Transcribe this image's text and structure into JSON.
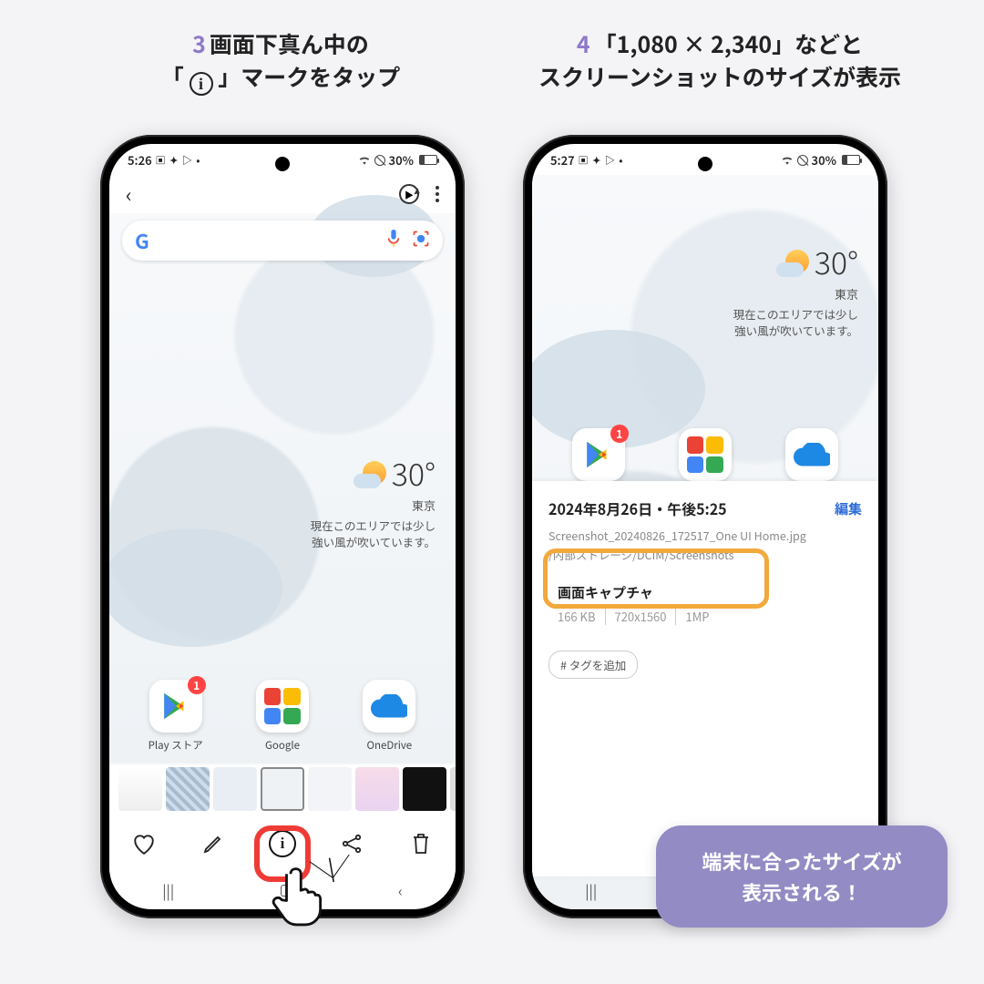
{
  "captions": {
    "step3_num": "3",
    "step3_line1": "画面下真ん中の",
    "step3_line2a": "「",
    "step3_line2b": "」マークをタップ",
    "step4_num": "4",
    "step4_line1": "「1,080 × 2,340」などと",
    "step4_line2": "スクリーンショットのサイズが表示"
  },
  "status": {
    "time_left": "5:26",
    "time_right": "5:27",
    "battery": "30%"
  },
  "weather": {
    "temp": "30°",
    "city": "東京",
    "note1": "現在このエリアでは少し",
    "note2": "強い風が吹いています。"
  },
  "apps": {
    "play": "Play ストア",
    "google": "Google",
    "onedrive": "OneDrive",
    "badge": "1"
  },
  "info_letter": "i",
  "panel": {
    "date": "2024年8月26日・午後5:25",
    "edit": "編集",
    "filename": "Screenshot_20240826_172517_One UI Home.jpg",
    "path": "/内部ストレージ/DCIM/Screenshots",
    "cap_title": "画面キャプチャ",
    "size": "166 KB",
    "res": "720x1560",
    "mp": "1MP",
    "tag": "# タグを追加"
  },
  "callout": {
    "line1": "端末に合ったサイズが",
    "line2": "表示される！"
  }
}
